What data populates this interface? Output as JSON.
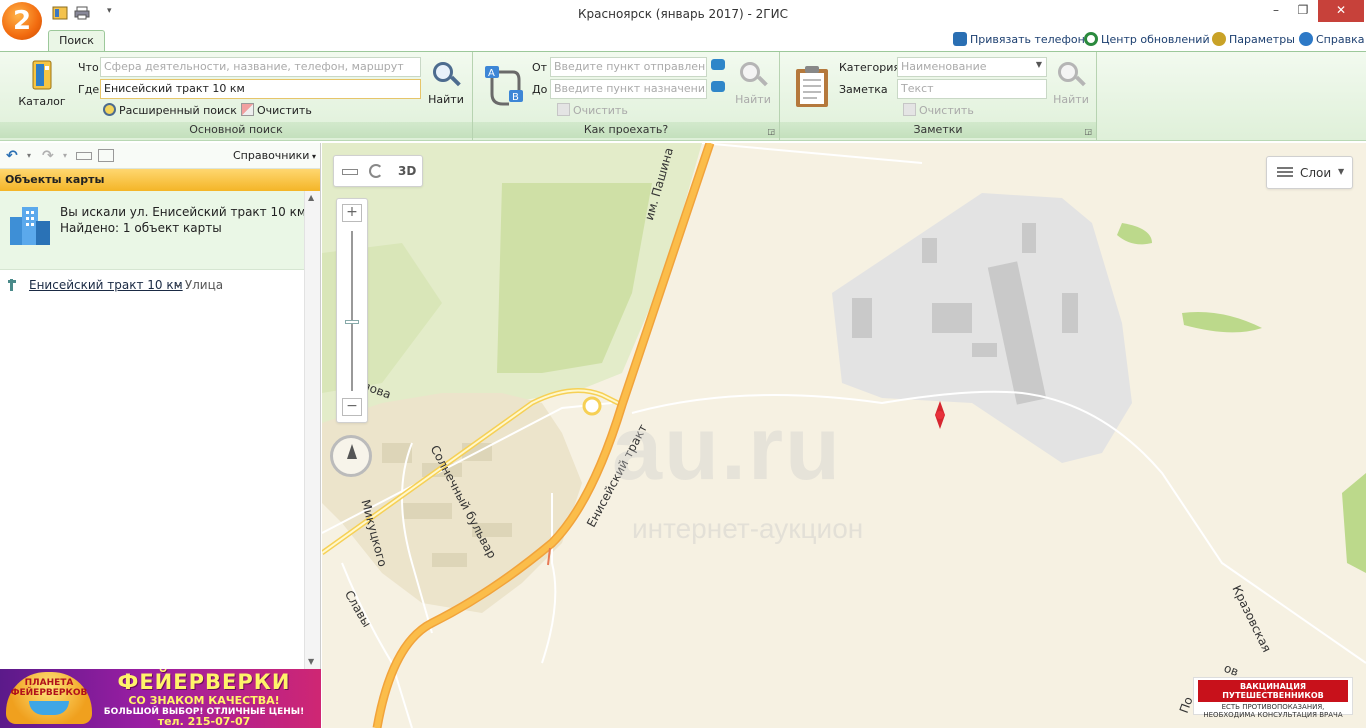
{
  "window": {
    "title": "Красноярск (январь 2017) - 2ГИС",
    "logo_text": "2",
    "minimize": "–",
    "maximize": "❐",
    "close": "✕"
  },
  "tabs": {
    "search": "Поиск"
  },
  "top_links": {
    "bind_phone": "Привязать телефон",
    "updates": "Центр обновлений",
    "settings": "Параметры",
    "help": "Справка"
  },
  "main_search": {
    "catalog_label": "Каталог",
    "what_label": "Что",
    "what_placeholder": "Сфера деятельности, название, телефон, маршрут",
    "where_label": "Где",
    "where_value": "Енисейский тракт 10 км",
    "find_label": "Найти",
    "advanced_label": "Расширенный поиск",
    "clear_label": "Очистить",
    "group_label": "Основной поиск"
  },
  "route": {
    "from_label": "От",
    "from_placeholder": "Введите пункт отправления",
    "to_label": "До",
    "to_placeholder": "Введите пункт назначения",
    "find_label": "Найти",
    "clear_label": "Очистить",
    "group_label": "Как проехать?"
  },
  "notes": {
    "category_label": "Категория",
    "category_placeholder": "Наименование",
    "note_label": "Заметка",
    "note_placeholder": "Текст",
    "find_label": "Найти",
    "clear_label": "Очистить",
    "group_label": "Заметки"
  },
  "sidebar": {
    "directory_label": "Справочники",
    "header": "Объекты карты",
    "summary_line1": "Вы искали ул. Енисейский тракт 10 км",
    "summary_line2": "Найдено: 1 объект карты",
    "result": {
      "name": "Енисейский тракт 10 км",
      "type": "– Улица"
    }
  },
  "banner": {
    "brand_line1": "ПЛАНЕТА",
    "brand_line2": "ФЕЙЕРВЕРКОВ",
    "headline": "ФЕЙЕРВЕРКИ",
    "subline": "СО ЗНАКОМ КАЧЕСТВА!",
    "offer": "БОЛЬШОЙ ВЫБОР! ОТЛИЧНЫЕ ЦЕНЫ!",
    "phone": "тел. 215-07-07"
  },
  "map": {
    "view_3d": "3D",
    "layers_label": "Слои",
    "zoom_in": "+",
    "zoom_out": "−",
    "streets": {
      "pashina": "им. Пашина",
      "yeniseysky": "Енисейский тракт",
      "solnechny": "Солнечный бульвар",
      "mikutskogo": "Микуцкого",
      "slavy": "Славы",
      "krazovskaya": "Кразовская",
      "partial_ova": "лова",
      "partial_po": "По",
      "partial_ov": "ов"
    },
    "watermark": "au.ru",
    "watermark_sub": "интернет-аукцион",
    "ad": {
      "title": "ВАКЦИНАЦИЯ ПУТЕШЕСТВЕННИКОВ",
      "line1": "ЕСТЬ ПРОТИВОПОКАЗАНИЯ,",
      "line2": "НЕОБХОДИМА КОНСУЛЬТАЦИЯ ВРАЧА"
    }
  }
}
